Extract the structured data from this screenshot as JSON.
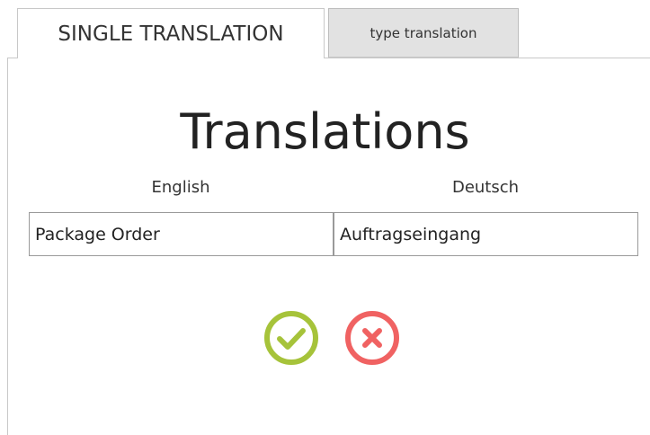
{
  "tabs": {
    "single": {
      "label": "SINGLE TRANSLATION",
      "active": true
    },
    "type": {
      "label": "type translation",
      "active": false
    }
  },
  "content": {
    "heading": "Translations",
    "columns": {
      "english": {
        "label": "English",
        "value": "Package Order"
      },
      "deutsch": {
        "label": "Deutsch",
        "value": "Auftragseingang"
      }
    }
  },
  "actions": {
    "confirm": {
      "icon": "check-circle-icon",
      "color": "#a6c33a"
    },
    "cancel": {
      "icon": "close-circle-icon",
      "color": "#f06262"
    }
  }
}
